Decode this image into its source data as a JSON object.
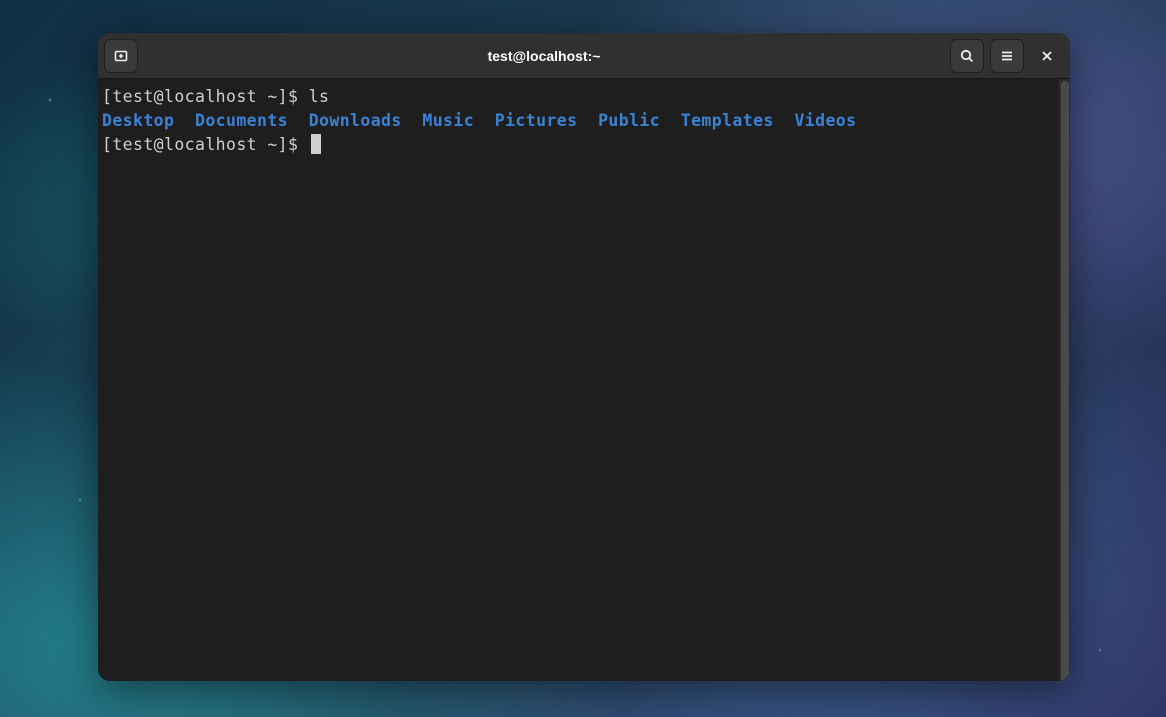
{
  "window": {
    "title": "test@localhost:~"
  },
  "terminal": {
    "line1": {
      "prompt": "[test@localhost ~]$ ",
      "command": "ls"
    },
    "ls_output": {
      "d0": "Desktop",
      "d1": "Documents",
      "d2": "Downloads",
      "d3": "Music",
      "d4": "Pictures",
      "d5": "Public",
      "d6": "Templates",
      "d7": "Videos"
    },
    "sep": "  ",
    "line3": {
      "prompt": "[test@localhost ~]$ "
    }
  }
}
